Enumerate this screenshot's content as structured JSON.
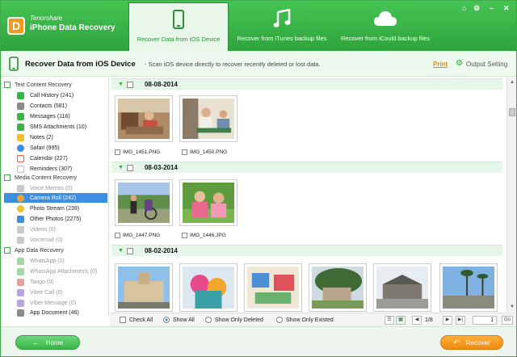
{
  "brand": {
    "company": "Tenorshare",
    "product": "iPhone Data Recovery",
    "logo_letter": "D"
  },
  "tabs": [
    {
      "label": "Recover Data from iOS Device",
      "icon": "phone-icon",
      "active": true
    },
    {
      "label": "Recover from iTunes backup files",
      "icon": "music-note-icon",
      "active": false
    },
    {
      "label": "Recover from iCould backup files",
      "icon": "cloud-icon",
      "active": false
    }
  ],
  "window_controls": {
    "home": "⌂",
    "settings": "⚙",
    "minimize": "–",
    "close": "✕"
  },
  "titlebar": {
    "title": "Recover Data from iOS Device",
    "description": "- Scan iOS device directly to recover recently deleted or lost data.",
    "print_label": "Print",
    "output_label": "Output Setting"
  },
  "sidebar": {
    "categories": [
      {
        "label": "Text Content Recovery",
        "items": [
          {
            "label": "Call History (241)",
            "color": "#39b548"
          },
          {
            "label": "Contacts (581)",
            "color": "#8a8a8a"
          },
          {
            "label": "Messages (116)",
            "color": "#39b548"
          },
          {
            "label": "SMS Attachments (10)",
            "color": "#39b548"
          },
          {
            "label": "Notes (2)",
            "color": "#f2c12e"
          },
          {
            "label": "Safari (995)",
            "color": "#3b8ee0"
          },
          {
            "label": "Calendar (227)",
            "color": "#e65a4a"
          },
          {
            "label": "Reminders (307)",
            "color": "#d9d9d9"
          }
        ]
      },
      {
        "label": "Media Content Recovery",
        "items": [
          {
            "label": "Voice Memos (0)",
            "color": "#9a9a9a",
            "dim": true
          },
          {
            "label": "Camera Roll (242)",
            "color": "#f3a33a",
            "selected": true
          },
          {
            "label": "Photo Stream (239)",
            "color": "#f2c12e"
          },
          {
            "label": "Other Photos (2275)",
            "color": "#3b8ee0"
          },
          {
            "label": "Videos (0)",
            "color": "#9a9a9a",
            "dim": true
          },
          {
            "label": "Voicemail (0)",
            "color": "#9a9a9a",
            "dim": true
          }
        ]
      },
      {
        "label": "App Data Recovery",
        "items": [
          {
            "label": "WhatsApp (0)",
            "color": "#7ac77f",
            "dim": true
          },
          {
            "label": "WhatsApp Attachments (0)",
            "color": "#7ac77f",
            "dim": true
          },
          {
            "label": "Tango (0)",
            "color": "#e07a7a",
            "dim": true
          },
          {
            "label": "Viber Call (0)",
            "color": "#9a7ad6",
            "dim": true
          },
          {
            "label": "Viber Message (0)",
            "color": "#9a7ad6",
            "dim": true
          },
          {
            "label": "App Document (46)",
            "color": "#8a8a8a"
          }
        ]
      }
    ]
  },
  "groups": [
    {
      "date": "08-08-2014",
      "photos": [
        {
          "name": "IMG_1451.PNG"
        },
        {
          "name": "IMG_1450.PNG"
        }
      ]
    },
    {
      "date": "08-03-2014",
      "photos": [
        {
          "name": "IMG_1447.PNG"
        },
        {
          "name": "IMG_1446.JPG"
        }
      ]
    },
    {
      "date": "08-02-2014",
      "photos": [
        {
          "name": ""
        },
        {
          "name": ""
        },
        {
          "name": ""
        },
        {
          "name": ""
        },
        {
          "name": ""
        },
        {
          "name": ""
        }
      ]
    }
  ],
  "filters": {
    "check_all": "Check All",
    "show_all": "Show All",
    "show_deleted": "Show Only Deleted",
    "show_existed": "Show Only Existed",
    "page_indicator": "1/8",
    "page_input": "1",
    "go_label": "Go"
  },
  "footer": {
    "home_label": "Home",
    "recover_label": "Recover"
  },
  "colors": {
    "brand_green": "#2fa43c",
    "accent_orange": "#f08a10",
    "selection_blue": "#3b8ee0"
  }
}
